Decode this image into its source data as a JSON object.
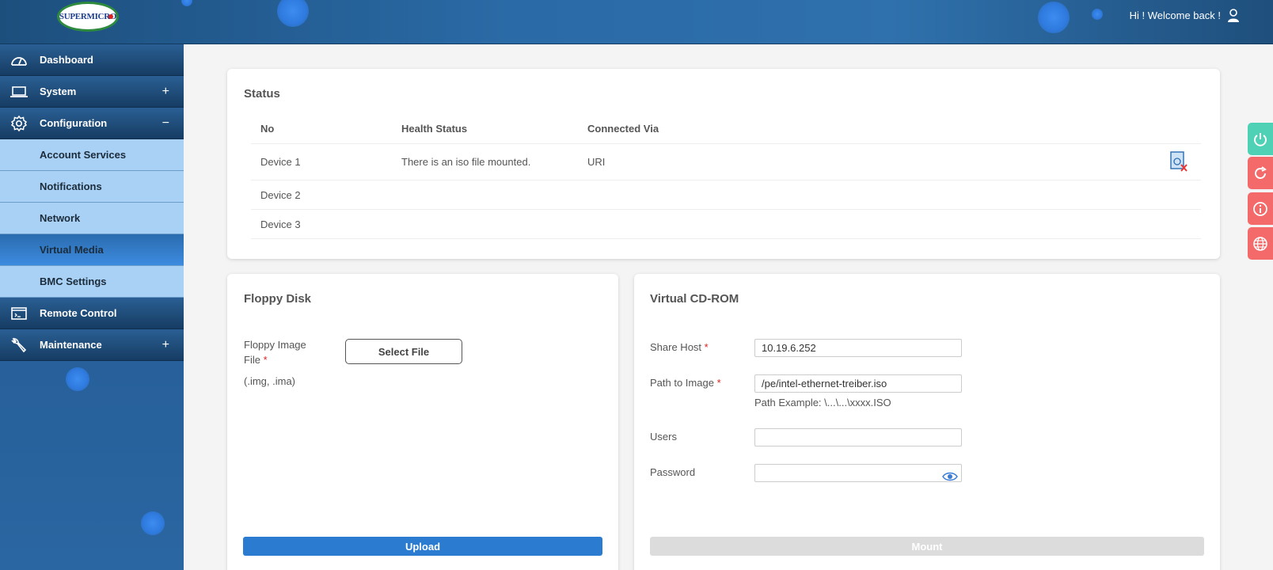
{
  "header": {
    "logo_text": "SUPERMICRO",
    "welcome": "Hi ! Welcome back !"
  },
  "sidebar": {
    "items": [
      {
        "label": "Dashboard",
        "icon": "gauge-icon",
        "toggle": ""
      },
      {
        "label": "System",
        "icon": "laptop-icon",
        "toggle": "+"
      },
      {
        "label": "Configuration",
        "icon": "gear-icon",
        "toggle": "−"
      }
    ],
    "sub_items": [
      {
        "label": "Account Services"
      },
      {
        "label": "Notifications"
      },
      {
        "label": "Network"
      },
      {
        "label": "Virtual Media",
        "active": true
      },
      {
        "label": "BMC Settings"
      }
    ],
    "items_after": [
      {
        "label": "Remote Control",
        "icon": "console-icon",
        "toggle": ""
      },
      {
        "label": "Maintenance",
        "icon": "wrench-icon",
        "toggle": "+"
      }
    ]
  },
  "status": {
    "title": "Status",
    "columns": [
      "No",
      "Health Status",
      "Connected Via"
    ],
    "rows": [
      {
        "no": "Device 1",
        "health": "There is an iso file mounted.",
        "via": "URI"
      },
      {
        "no": "Device 2",
        "health": "",
        "via": ""
      },
      {
        "no": "Device 3",
        "health": "",
        "via": ""
      }
    ]
  },
  "floppy": {
    "title": "Floppy Disk",
    "label_line1": "Floppy Image",
    "label_line2": "File",
    "required_mark": "*",
    "extensions": "(.img, .ima)",
    "select_button": "Select File",
    "upload_button": "Upload"
  },
  "cdrom": {
    "title": "Virtual CD-ROM",
    "share_host_label": "Share Host",
    "share_host_value": "10.19.6.252",
    "path_label": "Path to Image",
    "path_value": "/pe/intel-ethernet-treiber.iso",
    "path_example": "Path Example: \\...\\...\\xxxx.ISO",
    "users_label": "Users",
    "users_value": "",
    "password_label": "Password",
    "password_value": "",
    "required_mark": "*",
    "mount_button": "Mount"
  },
  "side_buttons": [
    "power-icon",
    "reset-icon",
    "info-icon",
    "globe-icon"
  ],
  "colors": {
    "header": "#2a6aa6",
    "sub_item_bg": "#a8d1f5",
    "upload": "#2b7bd1",
    "mount_disabled": "#dcdcdc",
    "power": "#4fd1b5",
    "alert": "#f46a6a"
  }
}
